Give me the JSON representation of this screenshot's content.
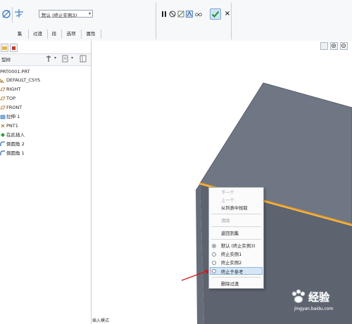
{
  "ribbon": {
    "combo_value": "默认 (终止实例3)",
    "tabs": [
      "集",
      "过渡",
      "段",
      "选项",
      "属性"
    ]
  },
  "left_panel": {
    "tree_title": "型树",
    "tree_items": [
      {
        "label": "PRT0001.PRT",
        "icon": "part-icon"
      },
      {
        "label": "DEFAULT_CSYS",
        "icon": "csys-icon"
      },
      {
        "label": "RIGHT",
        "icon": "datum-plane-icon"
      },
      {
        "label": "TOP",
        "icon": "datum-plane-icon"
      },
      {
        "label": "FRONT",
        "icon": "datum-plane-icon"
      },
      {
        "label": "拉伸 1",
        "icon": "extrude-icon"
      },
      {
        "label": "PNT1",
        "icon": "datum-point-icon"
      },
      {
        "label": "在此插入",
        "icon": "insert-here-icon"
      },
      {
        "label": "倒圆角 2",
        "icon": "round-icon"
      },
      {
        "label": "倒圆角 1",
        "icon": "round-icon"
      }
    ]
  },
  "context_menu": {
    "items": [
      {
        "label": "下一个",
        "disabled": true
      },
      {
        "label": "上一个",
        "disabled": true
      },
      {
        "label": "从列表中拾取",
        "disabled": false
      },
      {
        "label": "清除",
        "disabled": true
      },
      {
        "label": "返回到集",
        "disabled": false
      },
      {
        "label": "默认 (终止实例3)",
        "radio": true,
        "checked": true
      },
      {
        "label": "终止实例1",
        "radio": true,
        "checked": false
      },
      {
        "label": "终止实例2",
        "radio": true,
        "checked": false
      },
      {
        "label": "终止于参考",
        "radio": true,
        "checked": false,
        "highlighted": true
      },
      {
        "label": "删除过渡",
        "disabled": false
      }
    ]
  },
  "status_bar": {
    "text": "插入模式"
  },
  "colors": {
    "box_top": "#707784",
    "box_front": "#5d6470",
    "box_side": "#666d79",
    "edge_highlight": "#f0a020",
    "ok_check": "#1e8f2e",
    "menu_highlight": "#d5e6f7",
    "pointer_arrow": "#d01818"
  },
  "watermark": {
    "text": "经验",
    "sub": "jingyan.baidu.com"
  }
}
